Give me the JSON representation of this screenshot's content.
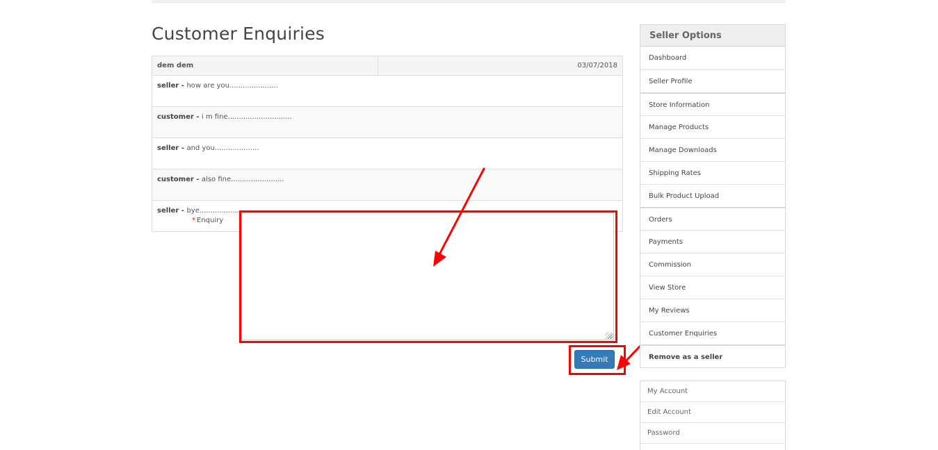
{
  "page": {
    "title": "Customer Enquiries"
  },
  "thread": {
    "customer_name": "dem dem",
    "date": "03/07/2018",
    "messages": [
      {
        "sender": "seller",
        "separator": " - ",
        "text": "how are you......................"
      },
      {
        "sender": "customer",
        "separator": " - ",
        "text": "i m fine............................."
      },
      {
        "sender": "seller",
        "separator": " - ",
        "text": "and you...................."
      },
      {
        "sender": "customer",
        "separator": " - ",
        "text": "also fine........................"
      },
      {
        "sender": "seller",
        "separator": " - ",
        "text": "bye................................"
      }
    ]
  },
  "form": {
    "required_mark": "*",
    "enquiry_label": "Enquiry",
    "enquiry_value": "",
    "submit_label": "Submit"
  },
  "seller_options": {
    "title": "Seller Options",
    "items": [
      "Dashboard",
      "Seller Profile",
      "Store Information",
      "Manage Products",
      "Manage Downloads",
      "Shipping Rates",
      "Bulk Product Upload",
      "Orders",
      "Payments",
      "Commission",
      "View Store",
      "My Reviews",
      "Customer Enquiries",
      "Remove as a seller"
    ]
  },
  "account": {
    "items": [
      "My Account",
      "Edit Account",
      "Password"
    ]
  },
  "colors": {
    "primary_button": "#337ab7",
    "annotation": "#ff0000",
    "required": "#ee0000"
  }
}
